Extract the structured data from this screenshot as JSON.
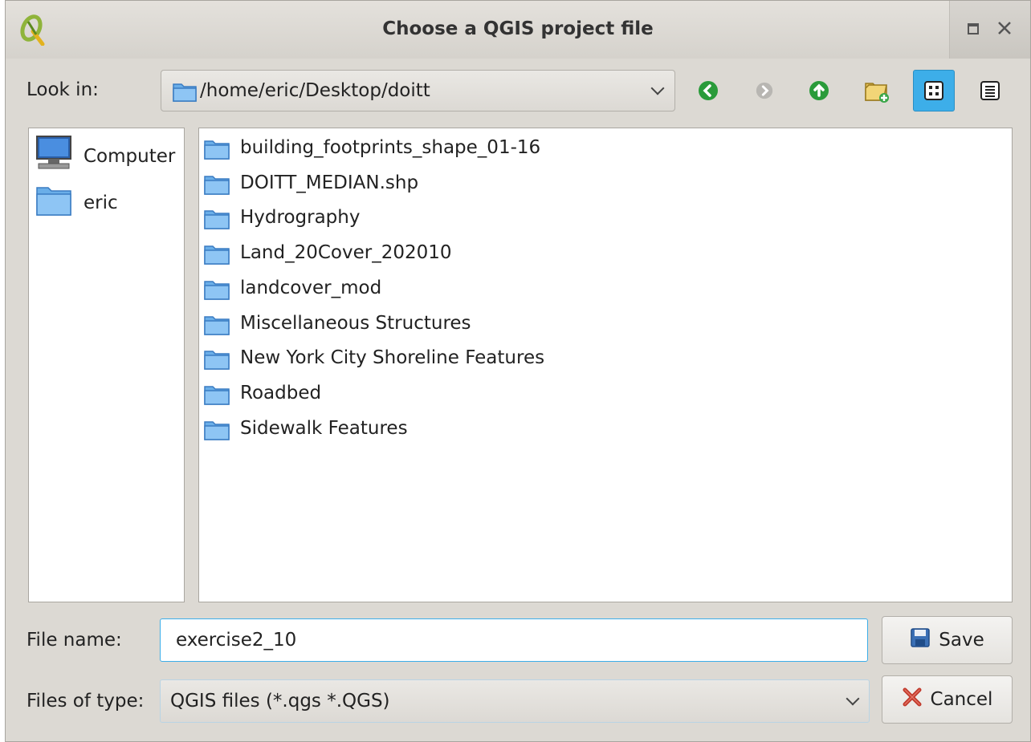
{
  "window": {
    "title": "Choose a QGIS project file"
  },
  "toolbar": {
    "look_in_label": "Look in:",
    "path": "/home/eric/Desktop/doitt",
    "buttons": [
      "back",
      "forward",
      "parent-directory",
      "new-folder",
      "icon-view",
      "detail-view"
    ],
    "active_view": "icon-view"
  },
  "sidebar": {
    "items": [
      {
        "label": "Computer",
        "icon": "computer-icon"
      },
      {
        "label": "eric",
        "icon": "folder-icon"
      }
    ]
  },
  "files": {
    "items": [
      {
        "name": "building_footprints_shape_01-16"
      },
      {
        "name": "DOITT_MEDIAN.shp"
      },
      {
        "name": "Hydrography"
      },
      {
        "name": "Land_20Cover_202010"
      },
      {
        "name": "landcover_mod"
      },
      {
        "name": "Miscellaneous Structures"
      },
      {
        "name": "New York City Shoreline Features"
      },
      {
        "name": "Roadbed"
      },
      {
        "name": "Sidewalk Features"
      }
    ]
  },
  "filename": {
    "label": "File name:",
    "value": "exercise2_10"
  },
  "filetype": {
    "label": "Files of type:",
    "selected": "QGIS files (*.qgs *.QGS)"
  },
  "buttons": {
    "save": "Save",
    "cancel": "Cancel"
  },
  "colors": {
    "accent": "#3daee9",
    "folder": "#4a90d9",
    "nav_green": "#2a9b3a"
  }
}
